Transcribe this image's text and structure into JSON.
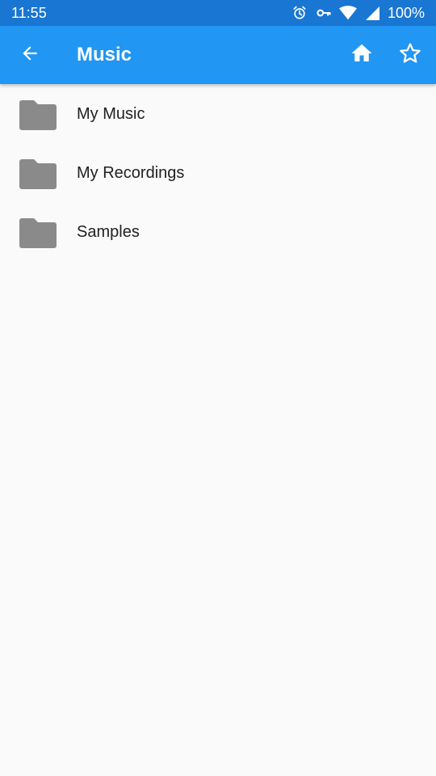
{
  "status_bar": {
    "time": "11:55",
    "battery": "100%",
    "icons": [
      "alarm-icon",
      "vpn-key-icon",
      "wifi-icon",
      "signal-icon"
    ]
  },
  "app_bar": {
    "title": "Music",
    "back_icon": "arrow-back-icon",
    "actions": [
      "home-icon",
      "star-outline-icon"
    ]
  },
  "folders": [
    {
      "name": "My Music",
      "icon": "folder-icon"
    },
    {
      "name": "My Recordings",
      "icon": "folder-icon"
    },
    {
      "name": "Samples",
      "icon": "folder-icon"
    }
  ],
  "colors": {
    "status_bar": "#1976d2",
    "app_bar": "#2196f3",
    "folder": "#8a8a8a",
    "background": "#fafafa"
  }
}
